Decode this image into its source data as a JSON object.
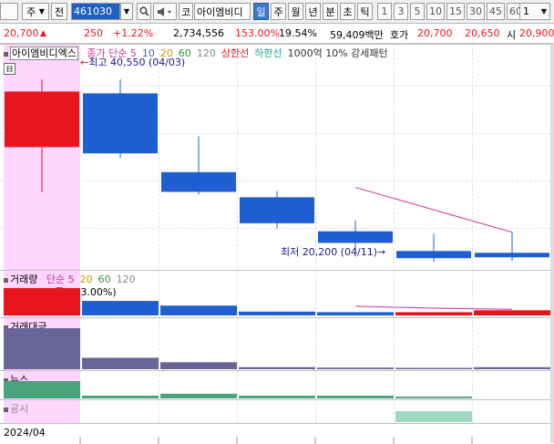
{
  "toolbar": {
    "market_label": "주",
    "prev_label": "전",
    "code": "461030",
    "dropdown_arrow": "▼",
    "speaker_icon": "speaker-icon",
    "type_label": "코",
    "stock_name": "아이엠비디",
    "periods": [
      "일",
      "주",
      "월",
      "년",
      "분",
      "초",
      "틱"
    ],
    "active_period": "일",
    "intervals": [
      "1",
      "3",
      "5",
      "10",
      "15",
      "30",
      "45",
      "60"
    ],
    "interval_select": "1"
  },
  "quote": {
    "price": "20,700",
    "arrow": "▲",
    "change": "250",
    "change_pct": "+1.22%",
    "volume": "2,734,556",
    "turnover_pct": "153.00%",
    "extra_pct": "19.54%",
    "amount": "59,409백만",
    "ask_label": "호가",
    "ask1": "20,700",
    "ask2": "20,650",
    "open_label": "시",
    "open": "20,900"
  },
  "price_pane": {
    "name": "아이엠비디엑스",
    "legend": [
      {
        "text": "종가 단순 5",
        "color": "#cc3399"
      },
      {
        "text": "10",
        "color": "#3366cc"
      },
      {
        "text": "20",
        "color": "#cc9900"
      },
      {
        "text": "60",
        "color": "#339933"
      },
      {
        "text": "120",
        "color": "#888888"
      },
      {
        "text": "상한선",
        "color": "#e8141e"
      },
      {
        "text": "하한선",
        "color": "#1f9e9e"
      },
      {
        "text": "1000억 10% 강세패턴",
        "color": "#333333"
      }
    ],
    "high_annotation": "최고 40,550 (04/03)",
    "low_annotation": "최저 20,200 (04/11)",
    "high_arrow": "←",
    "low_arrow": "→"
  },
  "volume_pane": {
    "title": "거래량",
    "legend": [
      {
        "text": "단순 5",
        "color": "#cc3399"
      },
      {
        "text": "20",
        "color": "#cc9900"
      },
      {
        "text": "60",
        "color": "#339933"
      },
      {
        "text": "120",
        "color": "#888888"
      }
    ],
    "readout": "2,734,556주(153.00%)"
  },
  "amount_pane": {
    "title": "거래대금"
  },
  "news_pane": {
    "title": "뉴스"
  },
  "disclosure_pane": {
    "title": "공시"
  },
  "bottom_axis": {
    "label": "2024/04"
  },
  "colors": {
    "up": "#e8141e",
    "down": "#1f5fcf",
    "amount": "#6a6597",
    "news": "#4aa37c",
    "disclosure": "#9fd9c1",
    "ma5": "#cc3399"
  },
  "chart_data": {
    "type": "candlestick",
    "candles": [
      {
        "open": 33000,
        "high": 40550,
        "low": 28000,
        "close": 39200,
        "dir": "up"
      },
      {
        "open": 39000,
        "high": 40550,
        "low": 31800,
        "close": 32300,
        "dir": "down"
      },
      {
        "open": 30200,
        "high": 34200,
        "low": 27700,
        "close": 28000,
        "dir": "down"
      },
      {
        "open": 27400,
        "high": 28100,
        "low": 23900,
        "close": 24500,
        "dir": "down"
      },
      {
        "open": 23600,
        "high": 24800,
        "low": 20800,
        "close": 22300,
        "dir": "down"
      },
      {
        "open": 21400,
        "high": 23300,
        "low": 20200,
        "close": 20600,
        "dir": "down"
      },
      {
        "open": 21200,
        "high": 23500,
        "low": 20300,
        "close": 20700,
        "dir": "down"
      }
    ],
    "ma5": [
      null,
      null,
      null,
      null,
      28500,
      26000,
      23500
    ],
    "volume": [
      1.0,
      0.53,
      0.36,
      0.14,
      0.12,
      0.12,
      0.19
    ],
    "volume_colors": [
      "up",
      "down",
      "down",
      "down",
      "down",
      "up",
      "up"
    ],
    "volume_ma5": [
      null,
      null,
      null,
      null,
      0.27,
      0.2,
      0.16
    ],
    "amount": [
      1.0,
      0.28,
      0.17,
      0.05,
      0.04,
      0.03,
      0.05
    ],
    "news": [
      1.0,
      0.16,
      0.27,
      0.16,
      0.16,
      0.1,
      0.0
    ],
    "disclosure": [
      0,
      0,
      0,
      0,
      0,
      1,
      0
    ],
    "ylim": [
      19500,
      42500
    ]
  }
}
